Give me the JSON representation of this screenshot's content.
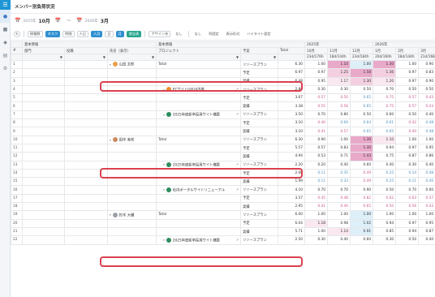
{
  "app": {
    "title": "メンバー別負荷状況"
  },
  "sidebar": {
    "items": [
      "home",
      "people",
      "org",
      "tasks",
      "settings"
    ]
  },
  "date_range": {
    "from_year": "2025年",
    "from_month": "10月",
    "to_year": "2026年",
    "to_month": "3月",
    "separator": "〜"
  },
  "toolbar": {
    "items": [
      {
        "label": "↻",
        "style": "round"
      },
      {
        "label": "稼働数",
        "style": "tb"
      },
      {
        "label": "タスク",
        "style": "on"
      },
      {
        "label": "時間",
        "style": "tb"
      },
      {
        "label": "人日",
        "style": "tb"
      },
      {
        "label": "人月",
        "style": "on"
      },
      {
        "label": "日",
        "style": "tb"
      },
      {
        "label": "月",
        "style": "on"
      },
      {
        "label": "割当表",
        "style": "gon"
      },
      {
        "label": "アサイン先",
        "style": "tb"
      },
      {
        "label": "なし",
        "style": "plain"
      },
      {
        "label": "なし",
        "style": "plain"
      },
      {
        "label": "列固定",
        "style": "plain"
      },
      {
        "label": "表示形式",
        "style": "plain"
      },
      {
        "label": "ハイライト設定",
        "style": "plain"
      },
      {
        "label": "",
        "style": "plain"
      }
    ]
  },
  "table": {
    "group_headers": [
      "基本情報",
      "基本情報"
    ],
    "years": [
      "2025年",
      "2026年"
    ],
    "headers": [
      "#",
      "部門",
      "役職",
      "氏名（表示）",
      "プロジェクト",
      "予実",
      "Total"
    ],
    "months": [
      "10月",
      "11月",
      "12月",
      "1月",
      "2月",
      "3月"
    ],
    "days": [
      "23d/176h",
      "18d/144h",
      "23d/184h",
      "20d/160h",
      "18d/144h",
      "21d/168h"
    ],
    "rows": [
      {
        "idx": "1",
        "name": "山田 太郎",
        "project": "Total",
        "type": "リソースプラン",
        "total": "6.30",
        "vals": [
          "1.00",
          "1.10",
          "1.00",
          "1.30",
          "1.00",
          "0.90"
        ],
        "cls": [
          "k",
          "hp",
          "lb",
          "hp",
          "k",
          "k"
        ],
        "level": "member",
        "avatar": "#e8a04d"
      },
      {
        "idx": "2",
        "type": "予定",
        "total": "6.97",
        "vals": [
          "0.97",
          "1.25",
          "1.58",
          "1.36",
          "0.97",
          "0.83"
        ],
        "cls": [
          "k",
          "mp",
          "hp",
          "mp",
          "k",
          "k"
        ]
      },
      {
        "idx": "3",
        "type": "実績",
        "total": "6.48",
        "vals": [
          "0.95",
          "1.17",
          "1.30",
          "1.20",
          "0.97",
          "0.90"
        ],
        "cls": [
          "k",
          "lp",
          "mp",
          "lp",
          "k",
          "k"
        ]
      },
      {
        "idx": "4",
        "project": "ECサイトUI/UX改善",
        "type": "リソースプラン",
        "total": "2.80",
        "vals": [
          "0.30",
          "0.30",
          "0.50",
          "0.70",
          "0.50",
          "0.50"
        ],
        "cls": [
          "k",
          "k",
          "k",
          "k",
          "k",
          "k"
        ],
        "level": "project",
        "pic": "o"
      },
      {
        "idx": "5",
        "type": "予定",
        "total": "3.67",
        "vals": [
          "0.57",
          "0.50",
          "0.65",
          "0.75",
          "0.57",
          "0.43"
        ],
        "cls": [
          "tp",
          "tp",
          "tb",
          "tp",
          "tp",
          "tp"
        ]
      },
      {
        "idx": "6",
        "type": "実績",
        "total": "3.38",
        "vals": [
          "0.55",
          "0.56",
          "0.65",
          "0.75",
          "0.57",
          "0.43"
        ],
        "cls": [
          "tp",
          "tp",
          "tb",
          "tp",
          "tp",
          "tp"
        ]
      },
      {
        "idx": "7",
        "project": "2025年度新卒採用サイト構築",
        "type": "リソースプラン",
        "total": "3.50",
        "vals": [
          "0.70",
          "0.80",
          "0.50",
          "0.60",
          "0.50",
          "0.40"
        ],
        "cls": [
          "k",
          "k",
          "k",
          "k",
          "k",
          "k"
        ],
        "level": "project",
        "pic": "g"
      },
      {
        "idx": "8",
        "type": "予定",
        "total": "3.10",
        "vals": [
          "0.40",
          "0.69",
          "0.64",
          "0.61",
          "0.42",
          "0.48"
        ],
        "cls": [
          "tp",
          "tb",
          "tb",
          "tb",
          "tp",
          "tb"
        ]
      },
      {
        "idx": "9",
        "type": "実績",
        "total": "3.10",
        "vals": [
          "0.41",
          "0.57",
          "0.65",
          "0.65",
          "0.40",
          "0.48"
        ],
        "cls": [
          "tp",
          "tp",
          "tb",
          "tb",
          "tp",
          "tb"
        ]
      },
      {
        "idx": "10",
        "name": "田中 美咲",
        "project": "Total",
        "type": "リソースプラン",
        "total": "6.30",
        "vals": [
          "0.90",
          "1.00",
          "1.30",
          "1.10",
          "1.00",
          "1.00"
        ],
        "cls": [
          "k",
          "k",
          "hp",
          "lp",
          "k",
          "k"
        ],
        "level": "member",
        "avatar": "#c98b5e"
      },
      {
        "idx": "11",
        "type": "予定",
        "total": "5.57",
        "vals": [
          "0.57",
          "0.83",
          "1.30",
          "0.94",
          "0.97",
          "0.95"
        ],
        "cls": [
          "k",
          "k",
          "hp",
          "k",
          "k",
          "k"
        ]
      },
      {
        "idx": "12",
        "type": "実績",
        "total": "4.94",
        "vals": [
          "0.53",
          "0.71",
          "1.43",
          "0.75",
          "0.87",
          "0.86"
        ],
        "cls": [
          "k",
          "k",
          "hp",
          "k",
          "k",
          "k"
        ]
      },
      {
        "idx": "13",
        "project": "2025年度新卒採用サイト構築",
        "type": "リソースプラン",
        "total": "2.20",
        "vals": [
          "0.20",
          "0.40",
          "0.60",
          "0.40",
          "0.30",
          "0.40"
        ],
        "cls": [
          "k",
          "k",
          "k",
          "k",
          "k",
          "k"
        ],
        "level": "project",
        "pic": "g"
      },
      {
        "idx": "14",
        "type": "予定",
        "total": "2.00",
        "vals": [
          "0.11",
          "0.35",
          "0.49",
          "0.25",
          "0.14",
          "0.48"
        ],
        "cls": [
          "tb",
          "tb",
          "tp",
          "tb",
          "tb",
          "tb"
        ]
      },
      {
        "idx": "15",
        "type": "実績",
        "total": "1.99",
        "vals": [
          "0.11",
          "0.33",
          "0.49",
          "0.25",
          "0.11",
          "0.40"
        ],
        "cls": [
          "tb",
          "tb",
          "tp",
          "tb",
          "tb",
          "tb"
        ]
      },
      {
        "idx": "16",
        "project": "社内ポータルサイトリニューアル",
        "type": "リソースプラン",
        "total": "4.10",
        "vals": [
          "0.70",
          "0.70",
          "0.90",
          "0.50",
          "0.70",
          "0.60"
        ],
        "cls": [
          "k",
          "k",
          "k",
          "k",
          "k",
          "k"
        ],
        "level": "project",
        "pic": "g"
      },
      {
        "idx": "17",
        "type": "予定",
        "total": "3.57",
        "vals": [
          "0.45",
          "0.48",
          "0.82",
          "0.62",
          "0.63",
          "0.57"
        ],
        "cls": [
          "tp",
          "tp",
          "tp",
          "tp",
          "tp",
          "tp"
        ]
      },
      {
        "idx": "18",
        "type": "実績",
        "total": "2.95",
        "vals": [
          "0.41",
          "0.40",
          "0.65",
          "0.50",
          "0.56",
          "0.43"
        ],
        "cls": [
          "tp",
          "tp",
          "tp",
          "tp",
          "tp",
          "tp"
        ]
      },
      {
        "idx": "19",
        "name": "鈴木 大輔",
        "project": "Total",
        "type": "リソースプラン",
        "total": "6.00",
        "vals": [
          "1.00",
          "1.00",
          "1.00",
          "1.00",
          "1.00",
          "1.00"
        ],
        "cls": [
          "k",
          "k",
          "lb",
          "k",
          "k",
          "k"
        ],
        "level": "member",
        "avatar": "#9aa1a8"
      },
      {
        "idx": "20",
        "type": "予定",
        "total": "6.04",
        "vals": [
          "1.18",
          "0.98",
          "1.02",
          "0.94",
          "0.97",
          "0.95"
        ],
        "cls": [
          "lp",
          "k",
          "lb",
          "k",
          "k",
          "k"
        ]
      },
      {
        "idx": "21",
        "type": "実績",
        "total": "5.71",
        "vals": [
          "1.00",
          "1.14",
          "0.91",
          "0.85",
          "0.94",
          "0.87"
        ],
        "cls": [
          "k",
          "lp",
          "lb",
          "k",
          "k",
          "k"
        ]
      },
      {
        "idx": "22",
        "project": "2025年度新卒採用サイト構築",
        "type": "リソースプラン",
        "total": "2.50",
        "vals": [
          "0.30",
          "0.40",
          "0.60",
          "0.30",
          "0.50",
          "0.40"
        ],
        "cls": [
          "k",
          "k",
          "k",
          "k",
          "k",
          "k"
        ],
        "level": "project",
        "pic": "g"
      }
    ]
  }
}
